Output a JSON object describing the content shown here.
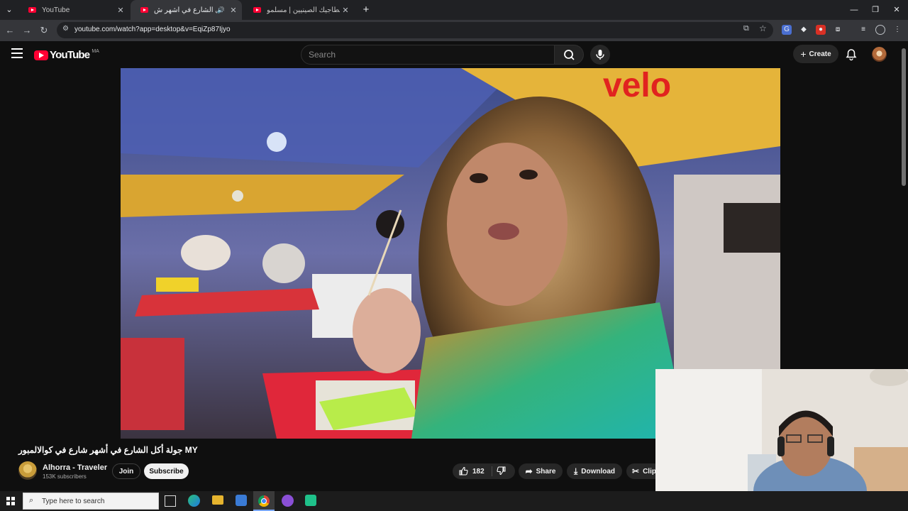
{
  "browser": {
    "tabs": [
      {
        "title": "YouTube",
        "active": false
      },
      {
        "title": "جولة أكل الشارع في أشهر ش",
        "active": true,
        "audio": true
      },
      {
        "title": "قبائل الطاجيك الصينيين | مسلمو...",
        "active": false
      }
    ],
    "new_tab": "+",
    "url": "youtube.com/watch?app=desktop&v=EqiZp87Ijyo"
  },
  "youtube": {
    "logo_text": "YouTube",
    "country_code": "MA",
    "search_placeholder": "Search",
    "create_label": "Create"
  },
  "video": {
    "title": "جولة أكل الشارع في أشهر شارع في كوالالمبور MY",
    "channel_name": "Alhorra - Traveler",
    "subscribers": "153K subscribers",
    "join_label": "Join",
    "subscribe_label": "Subscribe",
    "likes": "182",
    "share_label": "Share",
    "download_label": "Download",
    "clip_label": "Clip"
  },
  "taskbar": {
    "search_placeholder": "Type here to search"
  },
  "colors": {
    "yt_red": "#ff0033",
    "bg": "#0f0f0f",
    "chrome_dark": "#202124",
    "chrome_toolbar": "#35363a"
  }
}
